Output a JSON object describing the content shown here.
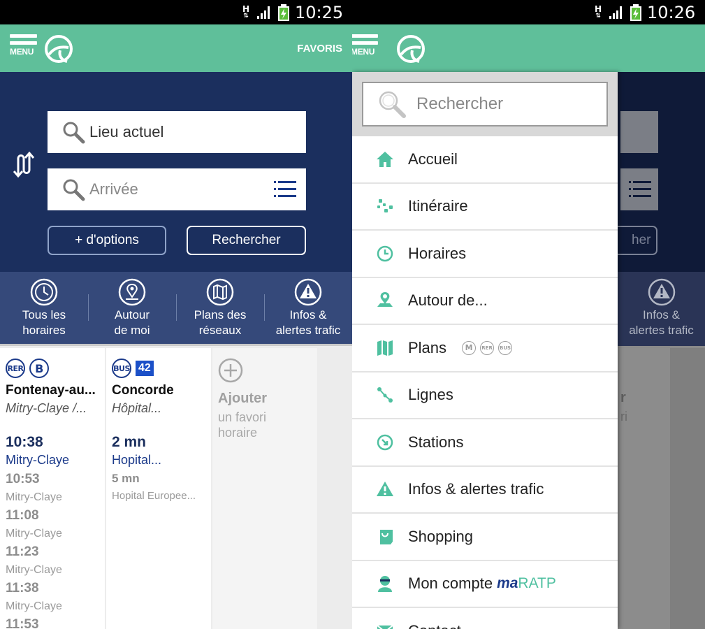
{
  "colors": {
    "accent_green": "#5fbf9a",
    "navy": "#1b2f5e",
    "tile_blue": "#35497a",
    "menu_icon": "#4fc0a0"
  },
  "left": {
    "status": {
      "time": "10:25",
      "network": "H"
    },
    "appbar": {
      "menu_label": "MENU",
      "favoris_label": "FAVORIS",
      "logo_icon": "ratp-logo-icon"
    },
    "search": {
      "from_value": "Lieu actuel",
      "to_placeholder": "Arrivée",
      "options_label": "+ d'options",
      "search_label": "Rechercher"
    },
    "quick": [
      {
        "icon": "clock-icon",
        "line1": "Tous les",
        "line2": "horaires"
      },
      {
        "icon": "location-pin-icon",
        "line1": "Autour",
        "line2": "de moi"
      },
      {
        "icon": "map-icon",
        "line1": "Plans des",
        "line2": "réseaux"
      },
      {
        "icon": "warning-icon",
        "line1": "Infos &",
        "line2": "alertes trafic"
      }
    ],
    "favorites": [
      {
        "badges": [
          "RER",
          "B"
        ],
        "stop": "Fontenay-au...",
        "direction": "Mitry-Claye /...",
        "first_time": "10:38",
        "first_dest": "Mitry-Claye",
        "next": [
          {
            "time": "10:53",
            "dest": "Mitry-Claye"
          },
          {
            "time": "11:08",
            "dest": "Mitry-Claye"
          },
          {
            "time": "11:23",
            "dest": "Mitry-Claye"
          },
          {
            "time": "11:38",
            "dest": "Mitry-Claye"
          },
          {
            "time": "11:53",
            "dest": ""
          }
        ]
      },
      {
        "badges": [
          "BUS",
          "42"
        ],
        "stop": "Concorde",
        "direction": "Hôpital...",
        "first_time": "2 mn",
        "first_dest": "Hopital...",
        "next": [
          {
            "time": "5 mn",
            "dest": "Hopital Europee..."
          }
        ]
      }
    ],
    "add_favorite": {
      "title": "Ajouter",
      "subtitle_line1": "un favori",
      "subtitle_line2": "horaire"
    }
  },
  "right": {
    "status": {
      "time": "10:26",
      "network": "H"
    },
    "appbar": {
      "menu_label": "MENU"
    },
    "underlay": {
      "search_fragment": "her",
      "quick_line1": "Infos &",
      "quick_line2": "alertes trafic",
      "fav_fragment1": "r",
      "fav_fragment2": "ri"
    },
    "drawer": {
      "search_placeholder": "Rechercher",
      "items": [
        {
          "label": "Accueil",
          "icon": "home-icon"
        },
        {
          "label": "Itinéraire",
          "icon": "route-icon"
        },
        {
          "label": "Horaires",
          "icon": "clock-icon"
        },
        {
          "label": "Autour de...",
          "icon": "location-pin-icon"
        },
        {
          "label": "Plans",
          "icon": "map-icon",
          "badges": [
            "M",
            "RER",
            "BUS"
          ]
        },
        {
          "label": "Lignes",
          "icon": "line-icon"
        },
        {
          "label": "Stations",
          "icon": "station-icon"
        },
        {
          "label": "Infos & alertes trafic",
          "icon": "warning-icon"
        },
        {
          "label": "Shopping",
          "icon": "shopping-bag-icon"
        },
        {
          "label": "Mon compte",
          "icon": "user-icon",
          "brand_ma": "ma",
          "brand_ratp": "RATP"
        },
        {
          "label": "Contact",
          "icon": "mail-icon"
        }
      ]
    }
  }
}
